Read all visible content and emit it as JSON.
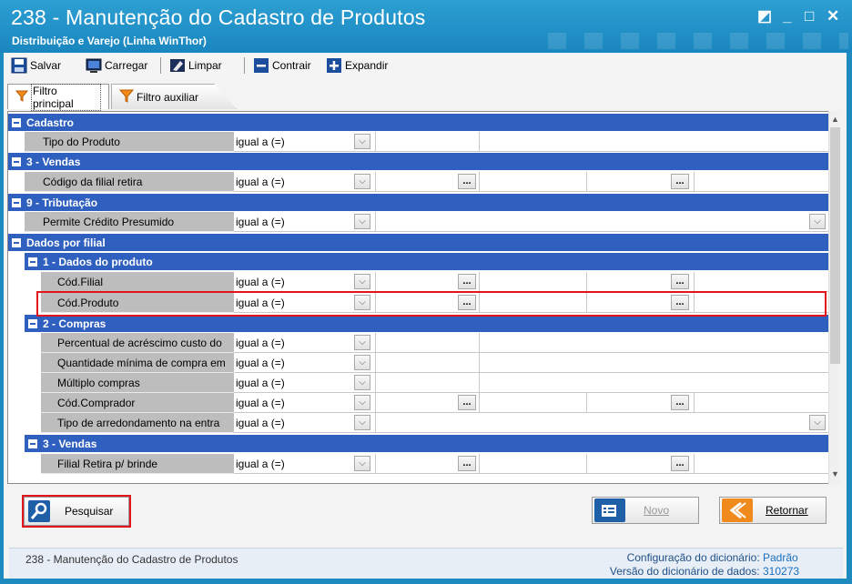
{
  "window": {
    "title": "238 - Manutenção do Cadastro de Produtos",
    "subtitle": "Distribuição e Varejo (Linha WinThor)",
    "controls": {
      "restore": "◩",
      "minimize": "_",
      "maximize": "□",
      "close": "✕"
    }
  },
  "toolbar": {
    "save": "Salvar",
    "load": "Carregar",
    "clear": "Limpar",
    "collapse": "Contrair",
    "expand": "Expandir"
  },
  "tabs": {
    "main": "Filtro principal",
    "aux": "Filtro auxiliar"
  },
  "operator_default": "igual a (=)",
  "ellipsis": "...",
  "groups": {
    "cadastro": "Cadastro",
    "vendas3": "3 - Vendas",
    "tributacao": "9 - Tributação",
    "dados_filial": "Dados por filial",
    "dados_produto": "1 - Dados do produto",
    "compras": "2 - Compras",
    "vendas3b": "3 - Vendas"
  },
  "rows": {
    "tipo_produto": "Tipo do Produto",
    "cod_filial_retira": "Código da filial retira",
    "credito_presumido": "Permite Crédito Presumido",
    "cod_filial": "Cód.Filial",
    "cod_produto": "Cód.Produto",
    "perc_acrescimo": "Percentual de acréscimo custo do",
    "qtd_minima": "Quantidade mínima de compra em",
    "multiplo_compras": "Múltiplo compras",
    "cod_comprador": "Cód.Comprador",
    "tipo_arredondamento": "Tipo de arredondamento na entra",
    "filial_retira_brinde": "Filial Retira p/ brinde"
  },
  "actions": {
    "search": "Pesquisar",
    "new": "Novo",
    "back": "Retornar"
  },
  "status": {
    "left": "238 - Manutenção do Cadastro de Produtos",
    "config_label": "Configuração do dicionário:",
    "config_value": "Padrão",
    "version_label": "Versão do dicionário de dados:",
    "version_value": "310273"
  },
  "colors": {
    "titlebar": "#1d8ac0",
    "group_header": "#2f5fbf",
    "highlight": "#e3141b"
  }
}
